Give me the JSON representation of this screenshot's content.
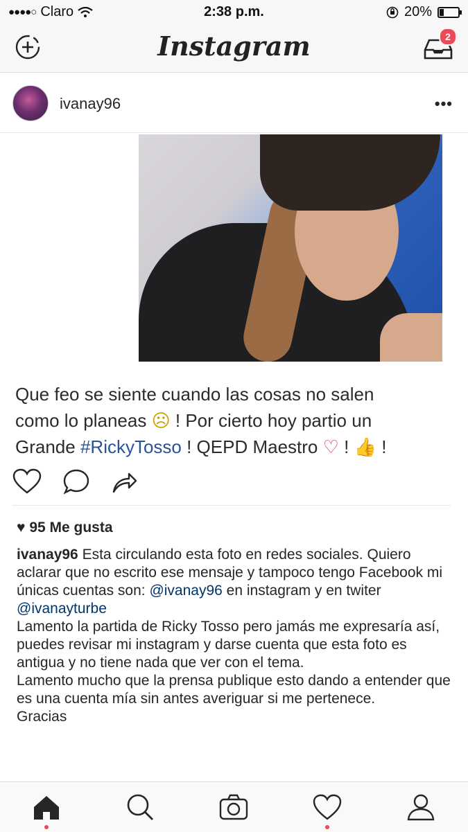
{
  "status_bar": {
    "carrier": "Claro",
    "time": "2:38 p.m.",
    "battery": "20%",
    "battery_level": 0.2
  },
  "nav": {
    "title": "Instagram",
    "inbox_badge": "2"
  },
  "post": {
    "username": "ivanay96",
    "image_caption": {
      "line1": "Que feo se siente cuando las cosas no salen",
      "line2a": "como lo planeas ",
      "line2emoji": "☹",
      "line2b": " ! Por cierto hoy partio un",
      "line3a": "Grande ",
      "hashtag": "#RickyTosso",
      "line3b": " ! QEPD Maestro ",
      "heart_emoji": "♡",
      "line3c": " ! ",
      "thumbs_emoji": "👍",
      "line3d": " !"
    },
    "likes": "95 Me gusta",
    "comment": {
      "username": "ivanay96",
      "p1a": " Esta circulando esta foto en redes sociales. Quiero aclarar que no escrito ese mensaje y tampoco tengo Facebook mi únicas cuentas son: ",
      "mention1": "@ivanay96",
      "p1b": " en instagram y en twiter ",
      "mention2": "@ivanayturbe",
      "p2": "Lamento la partida de Ricky Tosso pero jamás me expresaría así, puedes revisar mi instagram y darse cuenta que esta foto es antigua y no tiene nada que ver con el tema.",
      "p3": "Lamento mucho que la prensa publique esto dando a entender que es una cuenta mía sin antes averiguar si me pertenece.",
      "p4": "Gracias"
    }
  },
  "tab_bar": {
    "items": [
      "home-icon",
      "search-icon",
      "camera-icon",
      "heart-icon",
      "profile-icon"
    ],
    "active": "home-icon"
  },
  "colors": {
    "accent": "#ed4956",
    "mention": "#003569",
    "hashtag": "#2a5298"
  }
}
